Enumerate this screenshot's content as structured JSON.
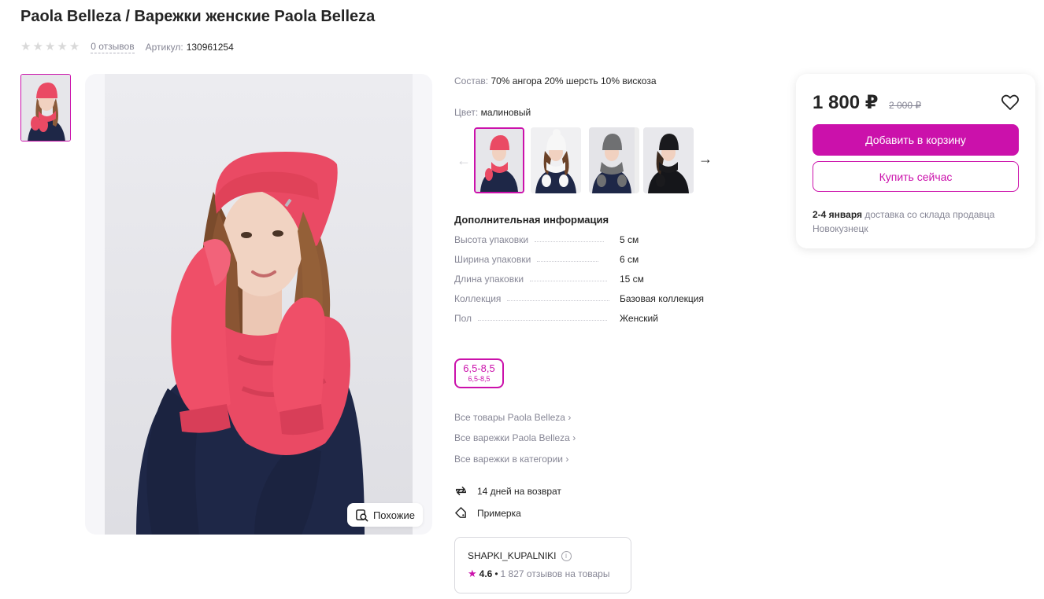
{
  "product": {
    "title": "Paola Belleza / Варежки женские Paola Belleza",
    "reviews_label": "0 отзывов",
    "rating_stars": 0,
    "article_label": "Артикул:",
    "article_value": "130961254"
  },
  "gallery": {
    "similar_label": "Похожие"
  },
  "details": {
    "composition_label": "Состав:",
    "composition_value": "70% ангора 20% шерсть 10% вискоза",
    "color_label": "Цвет:",
    "color_value": "малиновый",
    "color_variants": [
      "малиновый",
      "белый",
      "серый",
      "черный"
    ],
    "additional_title": "Дополнительная информация",
    "specs": [
      {
        "name": "Высота упаковки",
        "value": "5 см"
      },
      {
        "name": "Ширина упаковки",
        "value": "6 см"
      },
      {
        "name": "Длина упаковки",
        "value": "15 см"
      },
      {
        "name": "Коллекция",
        "value": "Базовая коллекция"
      },
      {
        "name": "Пол",
        "value": "Женский"
      }
    ],
    "size_main": "6,5-8,5",
    "size_sub": "6,5-8,5",
    "links": [
      "Все товары Paola Belleza",
      "Все варежки Paola Belleza",
      "Все варежки в категории"
    ],
    "return_label": "14 дней на возврат",
    "fitting_label": "Примерка"
  },
  "seller": {
    "name": "SHAPKI_KUPALNIKI",
    "rating": "4.6",
    "separator": "•",
    "reviews": "1 827 отзывов на товары"
  },
  "purchase": {
    "price": "1 800 ₽",
    "old_price": "2 000 ₽",
    "add_to_cart": "Добавить в корзину",
    "buy_now": "Купить сейчас",
    "delivery_date": "2-4 января",
    "delivery_text": "доставка со склада продавца Новокузнецк"
  },
  "colors": {
    "accent": "#cb11ab",
    "text": "#242424",
    "muted": "#868695",
    "hat": "#ea4a64",
    "sweater": "#1e2747"
  }
}
